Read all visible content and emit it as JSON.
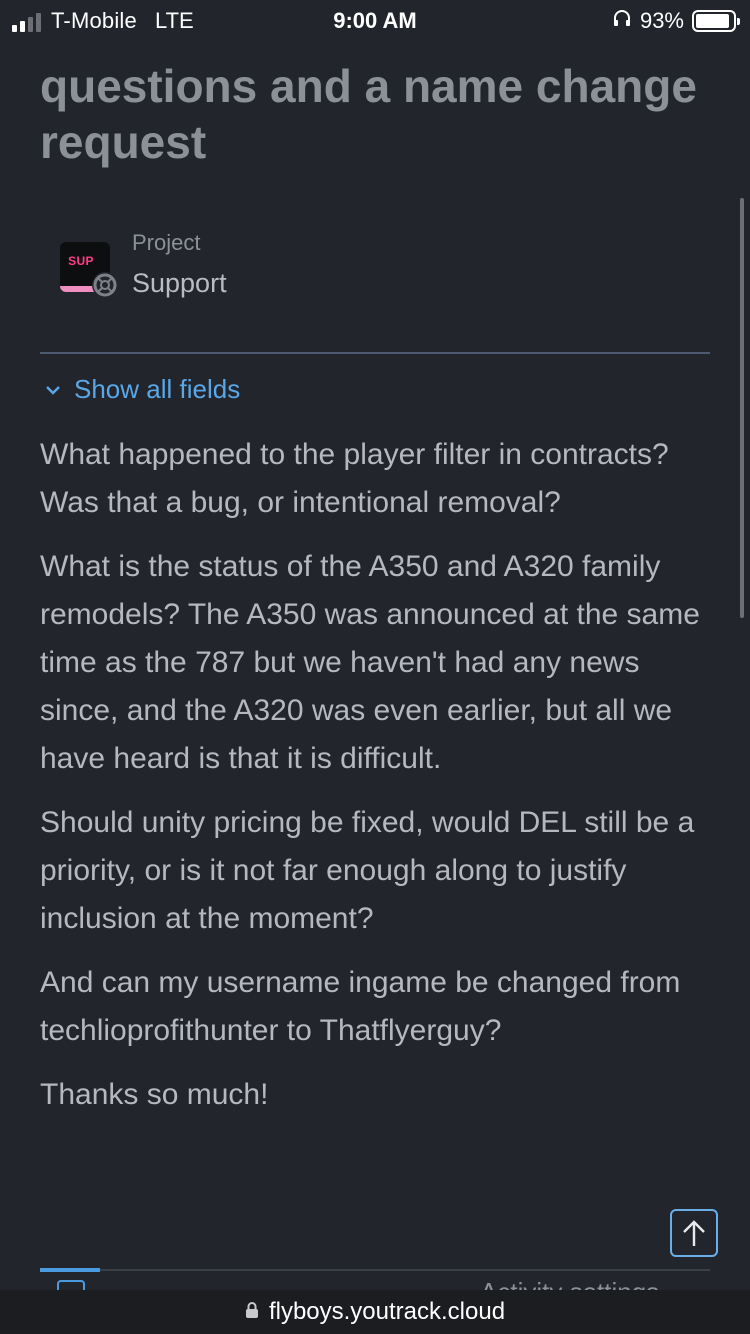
{
  "status_bar": {
    "carrier": "T-Mobile",
    "network": "LTE",
    "time": "9:00 AM",
    "battery": "93%",
    "battery_level": 0.93
  },
  "issue": {
    "title": "questions and a name change request",
    "project_label": "Project",
    "project_name": "Support",
    "project_badge": "SUP",
    "show_fields_label": "Show all fields",
    "body": [
      "What happened to the player filter in contracts? Was that a bug, or intentional removal?",
      "What is the status of the A350 and A320 family remodels? The A350 was announced at the same time as the 787 but we haven't had any news since, and the A320 was even earlier, but all we have heard is that it is difficult.",
      "Should unity pricing be fixed, would DEL still be a priority, or is it not far enough along to justify inclusion at the moment?",
      "And can my username ingame be changed from techlioprofithunter to Thatflyerguy?",
      "Thanks so much!"
    ]
  },
  "tabs": {
    "activity_settings": "Activity settings"
  },
  "browser": {
    "url": "flyboys.youtrack.cloud"
  },
  "icons": {
    "signal": "signal-icon",
    "headphones": "headphones-icon",
    "battery": "battery-icon",
    "chevron": "chevron-down-icon",
    "arrow_up": "arrow-up-icon",
    "lock": "lock-icon",
    "project": "project-icon"
  },
  "colors": {
    "background": "#22262c",
    "link": "#5aa7e8",
    "accent_pink": "#ff3d87"
  }
}
